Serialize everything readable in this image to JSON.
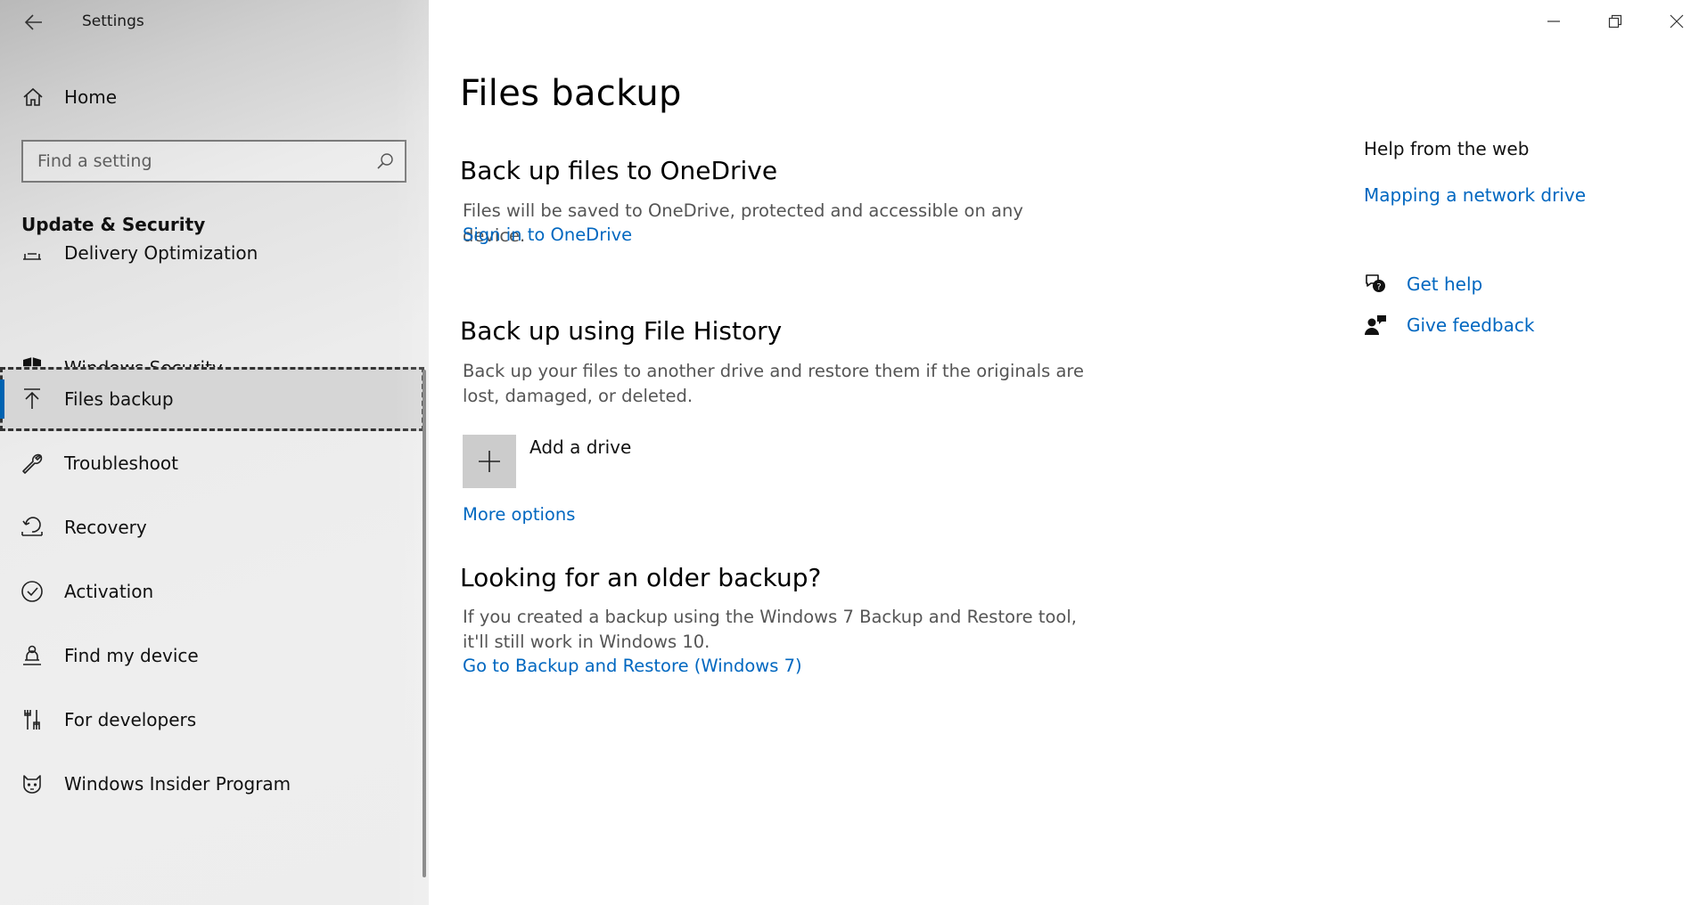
{
  "window": {
    "title": "Settings",
    "controls": [
      "minimize-icon",
      "restore-icon",
      "close-icon"
    ]
  },
  "sidebar": {
    "home_label": "Home",
    "search": {
      "placeholder": "Find a setting",
      "value": ""
    },
    "section_title": "Update & Security",
    "items": [
      {
        "label": "Delivery Optimization",
        "icon": "delivery-optimization-icon"
      },
      {
        "label": "Windows Security",
        "icon": "shield-icon"
      },
      {
        "label": "Files backup",
        "icon": "upload-arrow-icon",
        "selected": true
      },
      {
        "label": "Troubleshoot",
        "icon": "wrench-icon"
      },
      {
        "label": "Recovery",
        "icon": "recovery-icon"
      },
      {
        "label": "Activation",
        "icon": "check-circle-icon"
      },
      {
        "label": "Find my device",
        "icon": "person-location-icon"
      },
      {
        "label": "For developers",
        "icon": "developer-tools-icon"
      },
      {
        "label": "Windows Insider Program",
        "icon": "insider-cat-icon"
      }
    ]
  },
  "main": {
    "page_title": "Files backup",
    "onedrive": {
      "heading": "Back up files to OneDrive",
      "description": "Files will be saved to OneDrive, protected and accessible on any device.",
      "link": "Sign in to OneDrive"
    },
    "file_history": {
      "heading": "Back up using File History",
      "description": "Back up your files to another drive and restore them if the originals are lost, damaged, or deleted.",
      "add_drive_label": "Add a drive",
      "more_options": "More options"
    },
    "older_backup": {
      "heading": "Looking for an older backup?",
      "description": "If you created a backup using the Windows 7 Backup and Restore tool, it'll still work in Windows 10.",
      "link": "Go to Backup and Restore (Windows 7)"
    }
  },
  "help": {
    "title": "Help from the web",
    "web_link": "Mapping a network drive",
    "get_help": "Get help",
    "give_feedback": "Give feedback"
  },
  "colors": {
    "accent": "#0067c0",
    "selected_bg": "#d6d6d6",
    "selection_bar": "#0063b1"
  }
}
